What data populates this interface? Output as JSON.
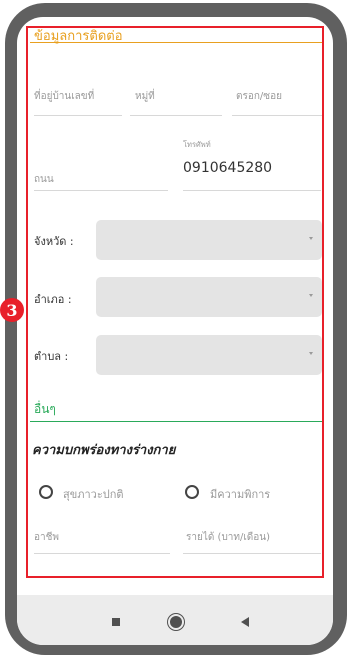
{
  "sections": {
    "contact_title": "ข้อมูลการติดต่อ",
    "other_title": "อื่นๆ",
    "disability_title": "ความบกพร่องทางร่างกาย"
  },
  "fields": {
    "house_no": "ที่อยู่บ้านเลขที่",
    "moo": "หมู่ที่",
    "soi": "ตรอก/ซอย",
    "road": "ถนน",
    "phone_caption": "โทรศัพท์",
    "phone_value": "0910645280",
    "occupation": "อาชีพ",
    "income": "รายได้ (บาท/เดือน)"
  },
  "selects": {
    "province_label": "จังหวัด :",
    "district_label": "อำเภอ :",
    "subdistrict_label": "ตำบล :"
  },
  "radios": {
    "normal": "สุขภาวะปกติ",
    "disabled": "มีความพิการ"
  },
  "marker": "3",
  "colors": {
    "accent_orange": "#e8a020",
    "accent_green": "#2aaa5a",
    "highlight_red": "#e8202a"
  }
}
